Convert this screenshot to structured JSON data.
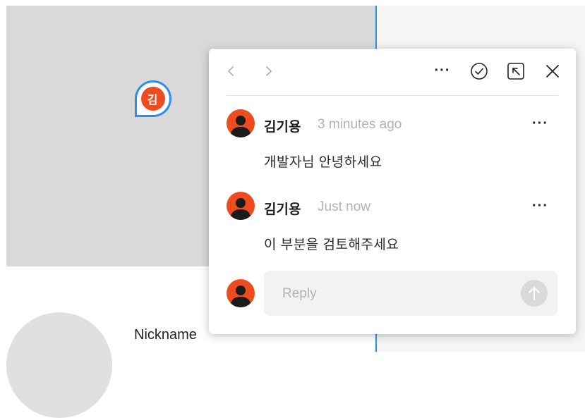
{
  "canvas": {
    "nickname_label": "Nickname",
    "pin_initial": "김",
    "pin_color": "#ee4b1f",
    "selection_color": "#2b8df0"
  },
  "header": {
    "icons": [
      "chevron-left-icon",
      "chevron-right-icon",
      "more-horizontal-icon",
      "resolve-check-icon",
      "open-in-icon",
      "close-icon"
    ],
    "more_glyph": "···"
  },
  "comments": [
    {
      "author": "김기용",
      "time": "3 minutes ago",
      "message": "개발자님  안녕하세요",
      "more_glyph": "···"
    },
    {
      "author": "김기용",
      "time": "Just now",
      "message": "이 부분을 검토해주세요",
      "more_glyph": "···"
    }
  ],
  "reply": {
    "placeholder": "Reply",
    "avatar_color": "#ee4b1f"
  }
}
